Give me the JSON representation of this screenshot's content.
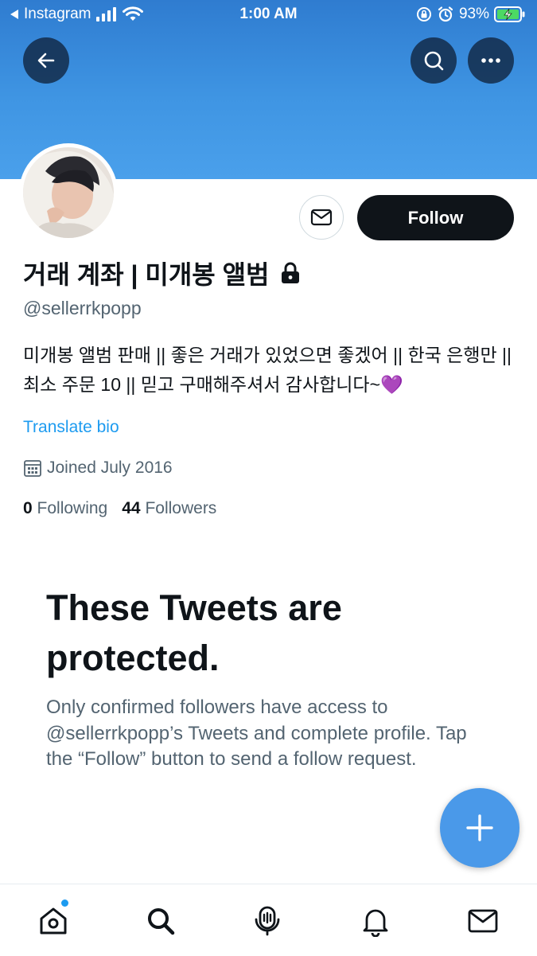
{
  "status_bar": {
    "back_app": "Instagram",
    "time": "1:00 AM",
    "battery": "93%"
  },
  "header": {
    "back_icon": "arrow-left-icon",
    "search_icon": "search-icon",
    "more_icon": "more-horizontal-icon",
    "banner_color": "#3f95e3"
  },
  "profile": {
    "display_name": "거래 계좌 | 미개봉 앨범",
    "handle": "@sellerrkpopp",
    "bio": "미개봉 앨범 판매 || 좋은 거래가 있었으면 좋겠어 || 한국 은행만 || 최소 주문 10 || 믿고 구매해주셔서 감사합니다~💜",
    "translate_label": "Translate bio",
    "joined": "Joined July 2016",
    "following_count": "0",
    "following_label": "Following",
    "followers_count": "44",
    "followers_label": "Followers"
  },
  "actions": {
    "follow_label": "Follow"
  },
  "protected": {
    "title": "These Tweets are protected.",
    "body": "Only confirmed followers have access to @sellerrkpopp’s Tweets and complete profile. Tap the “Follow” button to send a follow request."
  },
  "colors": {
    "accent": "#1d9bf0",
    "fab": "#4a99e9",
    "follow_button": "#0f1419"
  }
}
